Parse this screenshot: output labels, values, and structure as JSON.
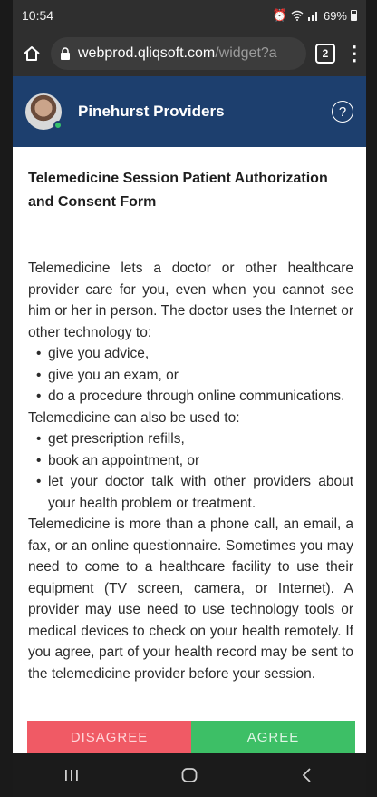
{
  "status_bar": {
    "time": "10:54",
    "battery": "69%"
  },
  "browser": {
    "url_main": "webprod.qliqsoft.com",
    "url_dim": "/widget?a",
    "tab_count": "2"
  },
  "header": {
    "title": "Pinehurst Providers",
    "help": "?"
  },
  "document": {
    "title": "Telemedicine Session Patient Authorization and Consent Form",
    "intro": "Telemedicine lets a doctor or other healthcare provider care for you, even when you cannot see him or her in person. The doctor uses the Internet or other technology to:",
    "list1": [
      "give you advice,",
      "give you an exam, or",
      "do a procedure through online communications."
    ],
    "also": "Telemedicine can also be used to:",
    "list2": [
      "get prescription refills,",
      "book an appointment, or",
      "let your doctor talk with other providers about your health problem or treatment."
    ],
    "body": "Telemedicine is more than a phone call, an email, a fax, or an online questionnaire. Sometimes you may need to come to a healthcare facility to use their equipment (TV screen, camera, or Internet). A provider may use need to use technology tools or medical devices to check on your health remotely. If you agree, part of your health record may be sent to the telemedicine provider before your session."
  },
  "actions": {
    "disagree": "DISAGREE",
    "agree": "AGREE"
  },
  "colors": {
    "header": "#1d3f6e",
    "disagree": "#f05a65",
    "agree": "#3dbf66"
  }
}
